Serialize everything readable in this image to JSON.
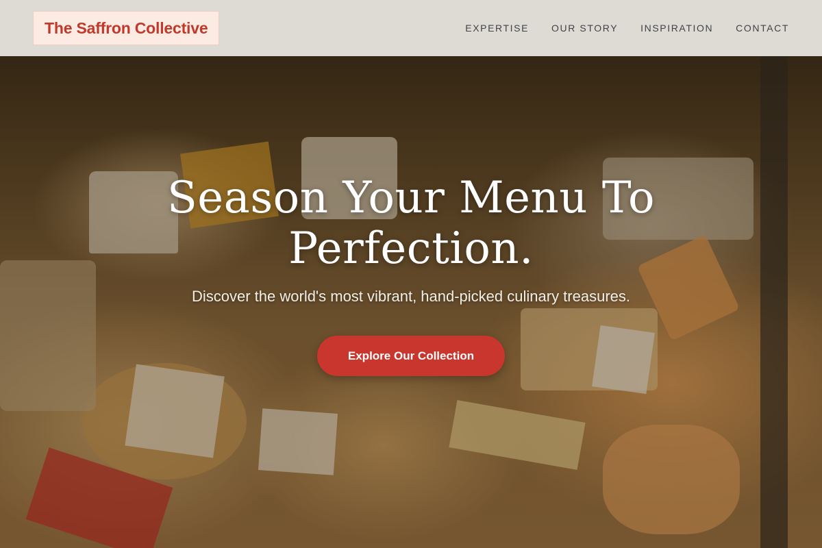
{
  "header": {
    "logo": "The Saffron Collective",
    "nav": [
      "EXPERTISE",
      "OUR STORY",
      "INSPIRATION",
      "CONTACT"
    ]
  },
  "hero": {
    "headline_line1": "Season Your Menu To",
    "headline_line2": "Perfection.",
    "subheadline": "Discover the world's most vibrant, hand-picked culinary treasures.",
    "cta_label": "Explore Our Collection",
    "background": "cheese-counter-photo"
  },
  "colors": {
    "accent": "#c9362d",
    "logo_text": "#c0392b",
    "header_bg": "#eceae4"
  }
}
